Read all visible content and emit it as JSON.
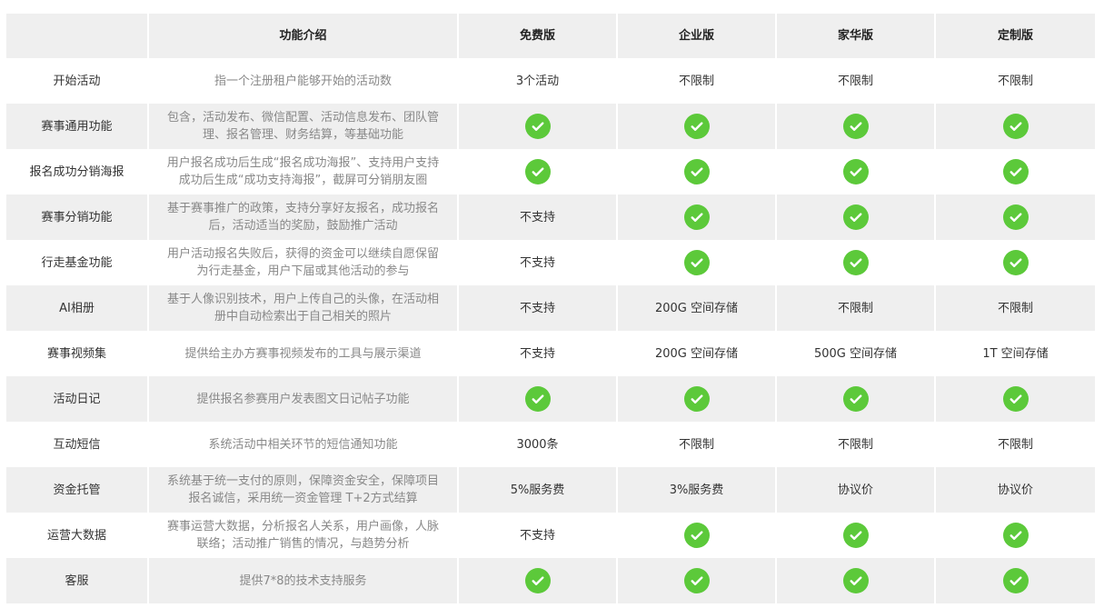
{
  "colors": {
    "check": "#5cc93a",
    "row_alt": "#efefef",
    "desc_text": "#888888"
  },
  "header": [
    "",
    "功能介绍",
    "免费版",
    "企业版",
    "家华版",
    "定制版"
  ],
  "rows": [
    {
      "feature": "开始活动",
      "desc": "指一个注册租户能够开始的活动数",
      "values": [
        "3个活动",
        "不限制",
        "不限制",
        "不限制"
      ]
    },
    {
      "feature": "赛事通用功能",
      "desc": "包含，活动发布、微信配置、活动信息发布、团队管理、报名管理、财务结算，等基础功能",
      "values": [
        "check",
        "check",
        "check",
        "check"
      ]
    },
    {
      "feature": "报名成功分销海报",
      "desc": "用户报名成功后生成“报名成功海报”、支持用户支持成功后生成“成功支持海报”，截屏可分销朋友圈",
      "values": [
        "check",
        "check",
        "check",
        "check"
      ]
    },
    {
      "feature": "赛事分销功能",
      "desc": "基于赛事推广的政策，支持分享好友报名，成功报名后，活动适当的奖励，鼓励推广活动",
      "values": [
        "不支持",
        "check",
        "check",
        "check"
      ]
    },
    {
      "feature": "行走基金功能",
      "desc": "用户活动报名失败后，获得的资金可以继续自愿保留为行走基金，用户下届或其他活动的参与",
      "values": [
        "不支持",
        "check",
        "check",
        "check"
      ]
    },
    {
      "feature": "AI相册",
      "desc": "基于人像识别技术，用户上传自己的头像，在活动相册中自动检索出于自己相关的照片",
      "values": [
        "不支持",
        "200G 空间存储",
        "不限制",
        "不限制"
      ]
    },
    {
      "feature": "赛事视频集",
      "desc": "提供给主办方赛事视频发布的工具与展示渠道",
      "values": [
        "不支持",
        "200G 空间存储",
        "500G 空间存储",
        "1T  空间存储"
      ]
    },
    {
      "feature": "活动日记",
      "desc": "提供报名参赛用户发表图文日记帖子功能",
      "values": [
        "check",
        "check",
        "check",
        "check"
      ]
    },
    {
      "feature": "互动短信",
      "desc": "系统活动中相关环节的短信通知功能",
      "values": [
        "3000条",
        "不限制",
        "不限制",
        "不限制"
      ]
    },
    {
      "feature": "资金托管",
      "desc": "系统基于统一支付的原则，保障资金安全，保障项目报名诚信，采用统一资金管理 T+2方式结算",
      "values": [
        "5%服务费",
        "3%服务费",
        "协议价",
        "协议价"
      ]
    },
    {
      "feature": "运营大数据",
      "desc": "赛事运营大数据，分析报名人关系，用户画像，人脉联络；活动推广销售的情况，与趋势分析",
      "values": [
        "不支持",
        "check",
        "check",
        "check"
      ]
    },
    {
      "feature": "客服",
      "desc": "提供7*8的技术支持服务",
      "values": [
        "check",
        "check",
        "check",
        "check"
      ]
    }
  ]
}
